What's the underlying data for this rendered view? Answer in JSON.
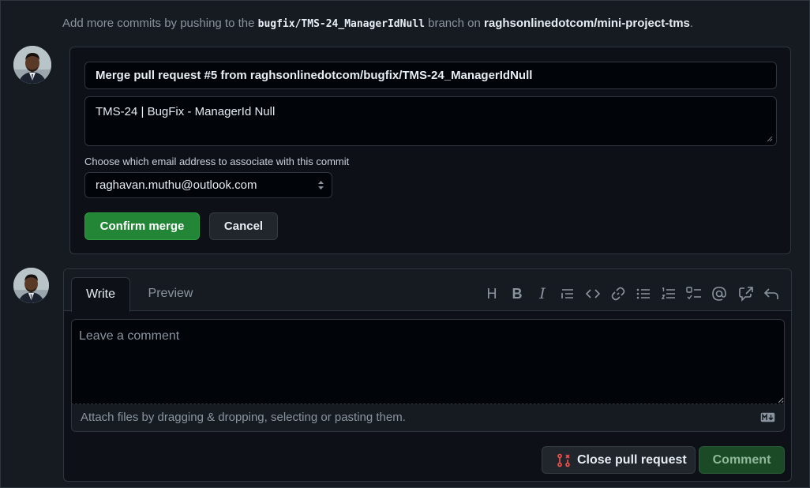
{
  "hint": {
    "prefix": "Add more commits by pushing to the",
    "branch": "bugfix/TMS-24_ManagerIdNull",
    "middle": "branch on",
    "repo": "raghsonlinedotcom/mini-project-tms",
    "suffix": "."
  },
  "merge": {
    "title": "Merge pull request #5 from raghsonlinedotcom/bugfix/TMS-24_ManagerIdNull",
    "description": "TMS-24 | BugFix - ManagerId Null",
    "email_label": "Choose which email address to associate with this commit",
    "email_selected": "raghavan.muthu@outlook.com",
    "confirm_label": "Confirm merge",
    "cancel_label": "Cancel"
  },
  "comment": {
    "tabs": [
      {
        "label": "Write",
        "active": true
      },
      {
        "label": "Preview",
        "active": false
      }
    ],
    "toolbar": [
      {
        "name": "heading-icon",
        "glyph": "H"
      },
      {
        "name": "bold-icon",
        "glyph": "B"
      },
      {
        "name": "italic-icon",
        "glyph": "I"
      },
      {
        "name": "quote-icon"
      },
      {
        "name": "code-icon"
      },
      {
        "name": "link-icon"
      },
      {
        "name": "unordered-list-icon"
      },
      {
        "name": "ordered-list-icon"
      },
      {
        "name": "task-list-icon"
      },
      {
        "name": "mention-icon"
      },
      {
        "name": "reference-icon"
      },
      {
        "name": "reply-icon"
      }
    ],
    "placeholder": "Leave a comment",
    "attach_text": "Attach files by dragging & dropping, selecting or pasting them.",
    "close_pr_label": "Close pull request",
    "comment_label": "Comment"
  },
  "colors": {
    "confirm_green": "#238636",
    "close_pr_icon": "#f85149",
    "comment_disabled": "#1b4a26"
  }
}
